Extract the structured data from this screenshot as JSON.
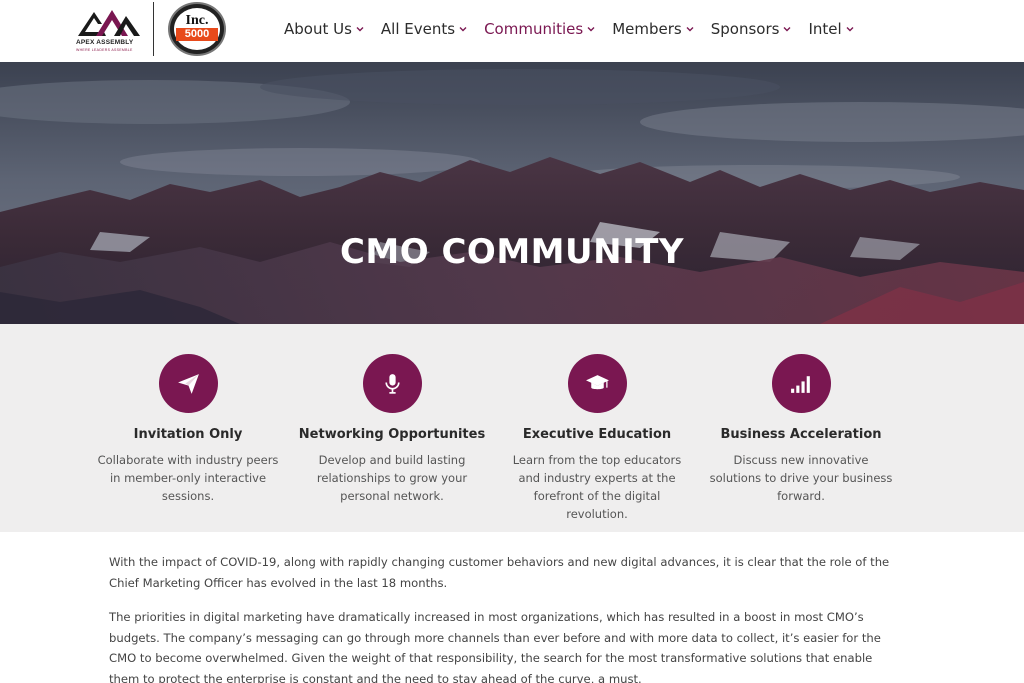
{
  "header": {
    "brand_name": "APEX ASSEMBLY",
    "brand_tagline": "WHERE LEADERS ASSEMBLE",
    "inc_logo_text": "Inc.",
    "inc_logo_number": "5000",
    "nav": [
      {
        "label": "About Us",
        "active": false
      },
      {
        "label": "All Events",
        "active": false
      },
      {
        "label": "Communities",
        "active": true
      },
      {
        "label": "Members",
        "active": false
      },
      {
        "label": "Sponsors",
        "active": false
      },
      {
        "label": "Intel",
        "active": false
      }
    ]
  },
  "hero": {
    "title": "CMO COMMUNITY"
  },
  "features": [
    {
      "icon": "paper-plane-icon",
      "title": "Invitation Only",
      "text": "Collaborate with industry peers in member-only interactive sessions."
    },
    {
      "icon": "microphone-icon",
      "title": "Networking Opportunites",
      "text": "Develop and build lasting relationships to grow your personal network."
    },
    {
      "icon": "graduation-cap-icon",
      "title": "Executive Education",
      "text": "Learn from the top educators and industry experts at the forefront of the digital revolution."
    },
    {
      "icon": "signal-bars-icon",
      "title": "Business Acceleration",
      "text": "Discuss new innovative solutions to drive your business forward."
    }
  ],
  "content": {
    "paragraphs": [
      "With the impact of COVID-19, along with rapidly changing customer behaviors and new digital advances, it is clear that the role of the Chief Marketing Officer has evolved in the last 18 months.",
      "The priorities in digital marketing have dramatically increased in most organizations, which has resulted in a boost in most CMO’s budgets. The company’s messaging can go through more channels than ever before and with more data to collect, it’s easier for the CMO to become overwhelmed. Given the weight of that responsibility, the search for the most transformative solutions that enable them to protect the enterprise is constant and the need to stay ahead of the curve, a must."
    ]
  },
  "colors": {
    "accent": "#7a1751",
    "nav_text": "#2c2c2c",
    "feature_bg": "#efeeee"
  }
}
